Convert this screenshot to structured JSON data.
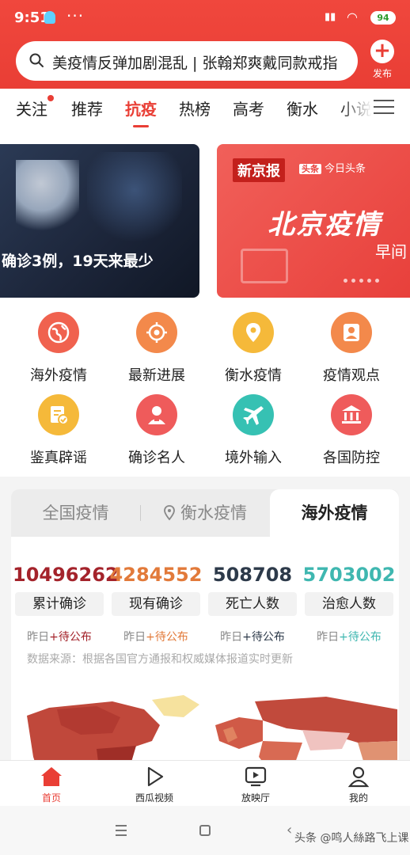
{
  "status_bar": {
    "time": "9:51",
    "dots": "···",
    "signal": "HD",
    "wifi": "WiFi",
    "battery": "94"
  },
  "search": {
    "text": "美疫情反弹加剧混乱 | 张翰郑爽戴同款戒指"
  },
  "publish": {
    "label": "发布",
    "icon": "plus-icon"
  },
  "tabs": [
    {
      "label": "关注",
      "badge": true
    },
    {
      "label": "推荐"
    },
    {
      "label": "抗疫",
      "active": true
    },
    {
      "label": "热榜"
    },
    {
      "label": "高考"
    },
    {
      "label": "衡水"
    },
    {
      "label": "小说"
    }
  ],
  "banners": {
    "left_caption": "确诊3例，19天来最少",
    "right_logo1": "新京报",
    "right_logo2_badge": "头条",
    "right_logo2_text": "今日头条",
    "right_title": "北京疫情",
    "right_sub": "早间"
  },
  "grid": [
    {
      "label": "海外疫情",
      "icon": "globe-icon",
      "color": "#f0624f"
    },
    {
      "label": "最新进展",
      "icon": "target-icon",
      "color": "#f3894b"
    },
    {
      "label": "衡水疫情",
      "icon": "location-pin-icon",
      "color": "#f5b93a"
    },
    {
      "label": "疫情观点",
      "icon": "person-card-icon",
      "color": "#f3894b"
    },
    {
      "label": "鉴真辟谣",
      "icon": "verified-doc-icon",
      "color": "#f5b93a"
    },
    {
      "label": "确诊名人",
      "icon": "person-icon",
      "color": "#ef5b5b"
    },
    {
      "label": "境外输入",
      "icon": "airplane-icon",
      "color": "#36c1b3"
    },
    {
      "label": "各国防控",
      "icon": "institution-icon",
      "color": "#ef5b5b"
    }
  ],
  "stats_tabs": [
    {
      "label": "全国疫情"
    },
    {
      "label": "衡水疫情"
    },
    {
      "label": "海外疫情",
      "active": true
    }
  ],
  "stats": [
    {
      "value": "10496262",
      "label": "累计确诊",
      "yest_prefix": "昨日",
      "yest_value": "+待公布",
      "color": "#a4232b"
    },
    {
      "value": "4284552",
      "label": "现有确诊",
      "yest_prefix": "昨日",
      "yest_value": "+待公布",
      "color": "#e27a3a"
    },
    {
      "value": "508708",
      "label": "死亡人数",
      "yest_prefix": "昨日",
      "yest_value": "+待公布",
      "color": "#2d3a4a"
    },
    {
      "value": "5703002",
      "label": "治愈人数",
      "yest_prefix": "昨日",
      "yest_value": "+待公布",
      "color": "#3fb7b0"
    }
  ],
  "source_note": "数据来源：根据各国官方通报和权威媒体报道实时更新",
  "bottom_nav": [
    {
      "label": "首页",
      "icon": "home-icon",
      "active": true
    },
    {
      "label": "西瓜视频",
      "icon": "play-icon"
    },
    {
      "label": "放映厅",
      "icon": "tv-icon"
    },
    {
      "label": "我的",
      "icon": "profile-icon"
    }
  ],
  "watermark": "头条 @鸣人絲路飞上课",
  "colors": {
    "brand_red": "#e93e35"
  }
}
